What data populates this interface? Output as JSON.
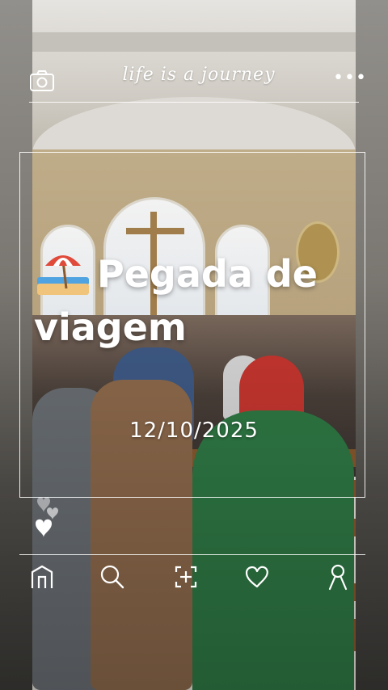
{
  "header": {
    "tagline": "life is a journey",
    "camera_icon": "camera-icon",
    "more_icon": "more-horizontal-icon",
    "more_glyph": "•••"
  },
  "post": {
    "title_line1": "Pegada de",
    "title_line2": "viagem",
    "title_emoji": "beach-umbrella-icon",
    "date": "12/10/2025"
  },
  "reactions": {
    "icon": "hearts-icon"
  },
  "nav": {
    "items": [
      {
        "icon": "home-icon"
      },
      {
        "icon": "search-icon"
      },
      {
        "icon": "add-scan-icon"
      },
      {
        "icon": "heart-icon"
      },
      {
        "icon": "profile-icon"
      }
    ]
  },
  "colors": {
    "overlay_text": "#ffffff",
    "line": "#ffffff"
  }
}
